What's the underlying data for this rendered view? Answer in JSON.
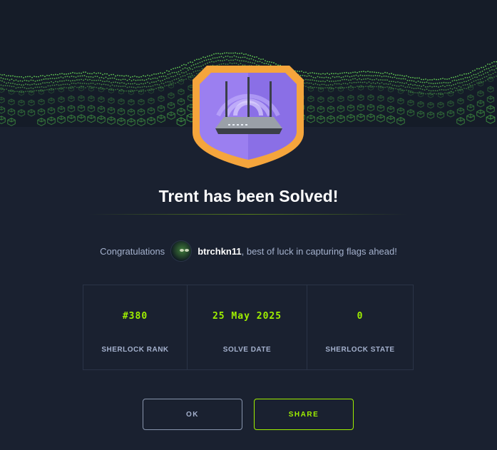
{
  "colors": {
    "background": "#1a2130",
    "accent": "#9fef00",
    "text_muted": "#a4b1cd",
    "badge_orange": "#f5a53c",
    "badge_purple": "#9b7ff0"
  },
  "icons": {
    "badge": "router-icon",
    "avatar": "user-avatar"
  },
  "title": "Trent has been Solved!",
  "congrats": {
    "prefix": "Congratulations",
    "username": "btrchkn11",
    "suffix": ", best of luck in capturing flags ahead!"
  },
  "stats": [
    {
      "value": "#380",
      "label": "SHERLOCK RANK"
    },
    {
      "value": "25 May 2025",
      "label": "SOLVE DATE"
    },
    {
      "value": "0",
      "label": "SHERLOCK STATE"
    }
  ],
  "buttons": {
    "ok": "OK",
    "share": "SHARE"
  }
}
